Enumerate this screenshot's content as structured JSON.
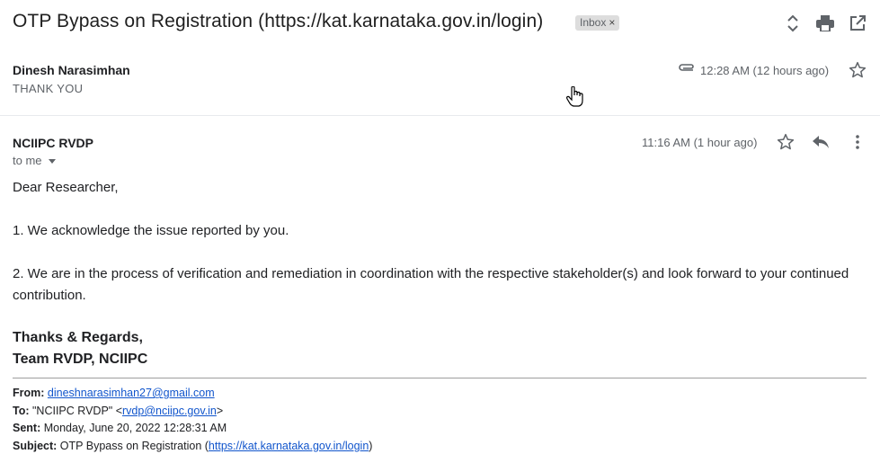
{
  "thread": {
    "subject": "OTP Bypass on Registration (https://kat.karnataka.gov.in/login)",
    "label_badge": "Inbox",
    "label_remove": "×"
  },
  "collapsed_message": {
    "sender": "Dinesh Narasimhan",
    "snippet": "THANK YOU",
    "time": "12:28 AM (12 hours ago)"
  },
  "expanded_message": {
    "sender": "NCIIPC RVDP",
    "recipient": "to me",
    "time": "11:16 AM (1 hour ago)",
    "greeting": "Dear Researcher,",
    "para1": "1. We acknowledge the issue reported by you.",
    "para2": "2. We are in the process of verification and remediation in coordination with the respective stakeholder(s) and look forward to your continued contribution.",
    "sign_line1": "Thanks & Regards,",
    "sign_line2": "Team RVDP, NCIIPC"
  },
  "quoted_header": {
    "from_label": "From:",
    "from_value": "dineshnarasimhan27@gmail.com",
    "to_label": "To:",
    "to_prefix": "\"NCIIPC RVDP\" <",
    "to_link": "rvdp@nciipc.gov.in",
    "to_suffix": ">",
    "sent_label": "Sent:",
    "sent_value": "Monday, June 20, 2022 12:28:31 AM",
    "subject_label": "Subject:",
    "subject_prefix": "OTP Bypass on Registration (",
    "subject_link": "https://kat.karnataka.gov.in/login",
    "subject_suffix": ")"
  },
  "colors": {
    "link": "#1155cc",
    "icon": "#5f6368",
    "badge_bg": "#dddddd"
  }
}
